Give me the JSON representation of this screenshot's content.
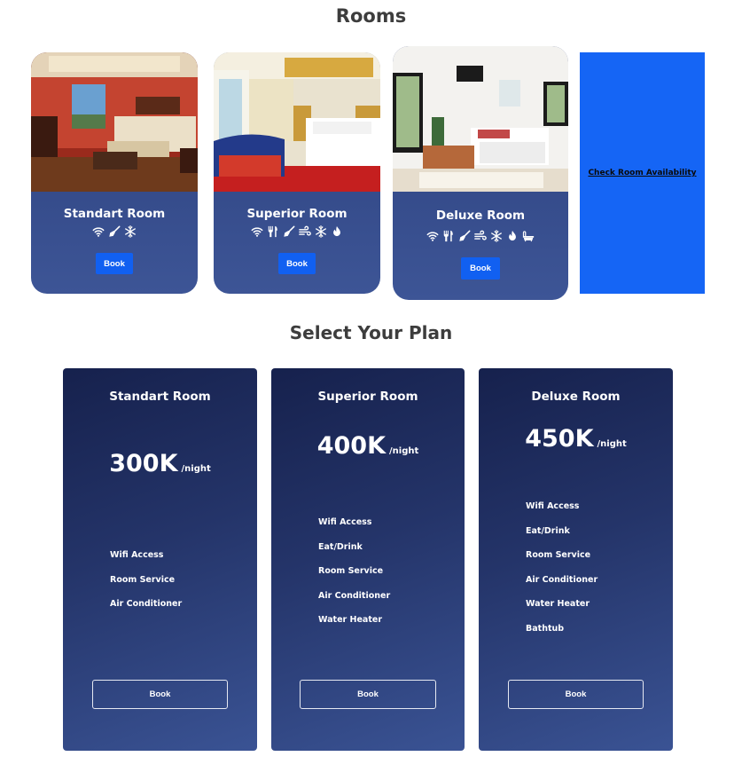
{
  "rooms_section": {
    "title": "Rooms",
    "cards": [
      {
        "name": "Standart Room",
        "book_label": "Book",
        "amenities": [
          "wifi-icon",
          "broom-icon",
          "snowflake-icon"
        ]
      },
      {
        "name": "Superior Room",
        "book_label": "Book",
        "amenities": [
          "wifi-icon",
          "utensils-icon",
          "broom-icon",
          "wind-icon",
          "snowflake-icon",
          "fire-icon"
        ]
      },
      {
        "name": "Deluxe Room",
        "book_label": "Book",
        "amenities": [
          "wifi-icon",
          "utensils-icon",
          "broom-icon",
          "wind-icon",
          "snowflake-icon",
          "fire-icon",
          "bathtub-icon"
        ]
      }
    ],
    "availability_link": "Check Room Availability"
  },
  "plans_section": {
    "title": "Select Your Plan",
    "plans": [
      {
        "name": "Standart Room",
        "price": "300K",
        "per": "/night",
        "features": [
          "Wifi Access",
          "Room Service",
          "Air Conditioner"
        ],
        "book_label": "Book"
      },
      {
        "name": "Superior Room",
        "price": "400K",
        "per": "/night",
        "features": [
          "Wifi Access",
          "Eat/Drink",
          "Room Service",
          "Air Conditioner",
          "Water Heater"
        ],
        "book_label": "Book"
      },
      {
        "name": "Deluxe Room",
        "price": "450K",
        "per": "/night",
        "features": [
          "Wifi Access",
          "Eat/Drink",
          "Room Service",
          "Air Conditioner",
          "Water Heater",
          "Bathtub"
        ],
        "book_label": "Book"
      }
    ]
  },
  "colors": {
    "card_gradient_top": "#2b3f7c",
    "card_gradient_bottom": "#3d5596",
    "book_button": "#1160f1",
    "availability_panel": "#1565f5",
    "plan_dark": "#16214d"
  }
}
